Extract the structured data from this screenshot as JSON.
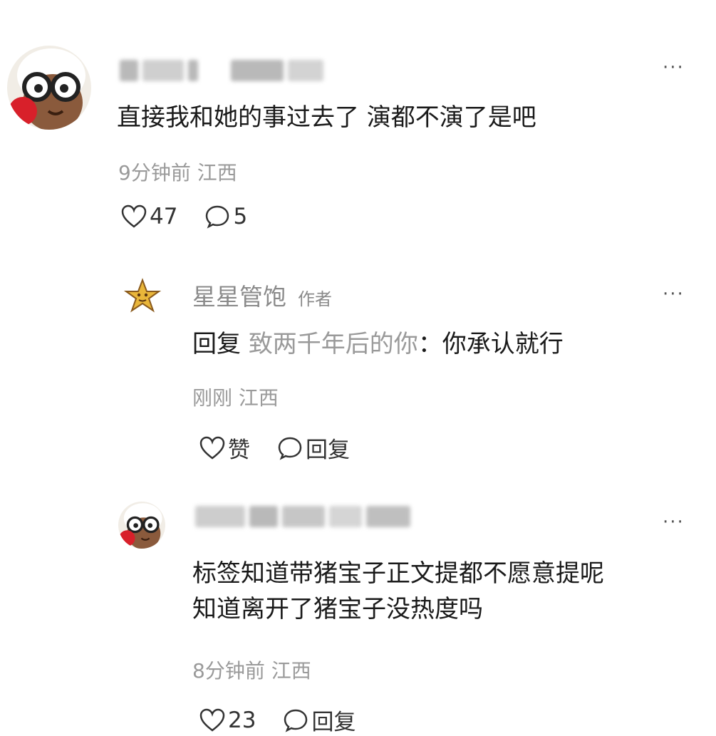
{
  "comments": [
    {
      "author": "",
      "content": [
        "直接我和她的事过去了 演都不演了是吧"
      ],
      "time": "9分钟前",
      "location": "江西",
      "likes": "47",
      "replies": "5",
      "avatar_icon": "cartoon-glasses-avatar-icon"
    },
    {
      "author": "星星管饱",
      "author_tag": "作者",
      "reply_keyword": "回复",
      "reply_target": "致两千年后的你",
      "reply_text": "：你承认就行",
      "time": "刚刚",
      "location": "江西",
      "like_label": "赞",
      "reply_label": "回复",
      "avatar_icon": "star-avatar-icon"
    },
    {
      "author": "",
      "content": [
        "标签知道带猪宝子正文提都不愿意提呢",
        "知道离开了猪宝子没热度吗"
      ],
      "time": "8分钟前",
      "location": "江西",
      "likes": "23",
      "reply_label": "回复",
      "avatar_icon": "cartoon-glasses-avatar-icon"
    }
  ],
  "more_glyph": "···"
}
